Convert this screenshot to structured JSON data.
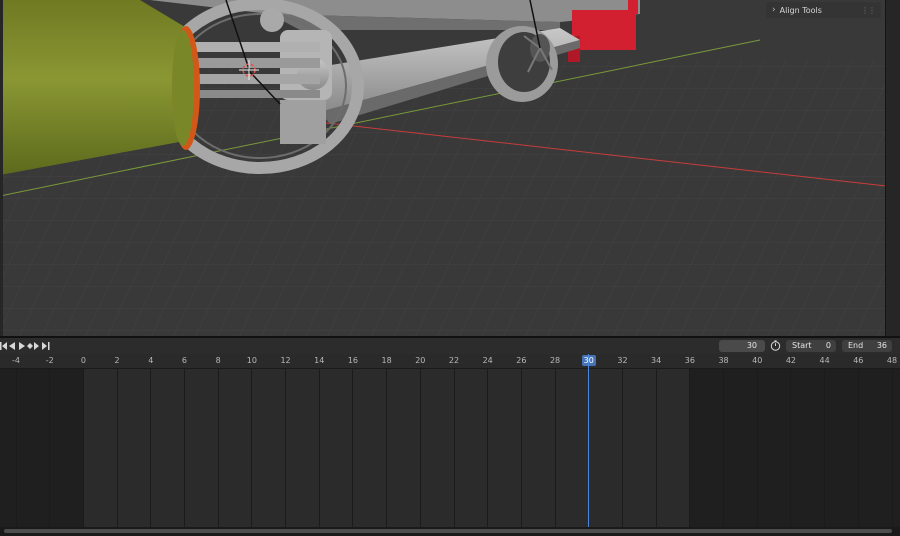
{
  "viewport": {
    "align_panel": {
      "label": "Align Tools"
    }
  },
  "timeline": {
    "current_frame": "30",
    "start_label": "Start",
    "start_value": "0",
    "end_label": "End",
    "end_value": "36",
    "ruler_ticks": [
      "-4",
      "-2",
      "0",
      "2",
      "4",
      "6",
      "8",
      "10",
      "12",
      "14",
      "16",
      "18",
      "20",
      "22",
      "24",
      "26",
      "28",
      "30",
      "32",
      "34",
      "36",
      "38",
      "40",
      "42",
      "44",
      "46",
      "48"
    ],
    "playback_icons": [
      "jump-start-icon",
      "play-reverse-icon",
      "play-icon",
      "jump-keyframe-icon",
      "jump-end-icon"
    ]
  },
  "colors": {
    "accent": "#4772b3",
    "viewport_bg": "#393939",
    "x_axis": "#c83c3c",
    "y_axis": "#7a9a3a",
    "cylinder_green": "#7d8a2c",
    "red_part": "#d22030"
  }
}
